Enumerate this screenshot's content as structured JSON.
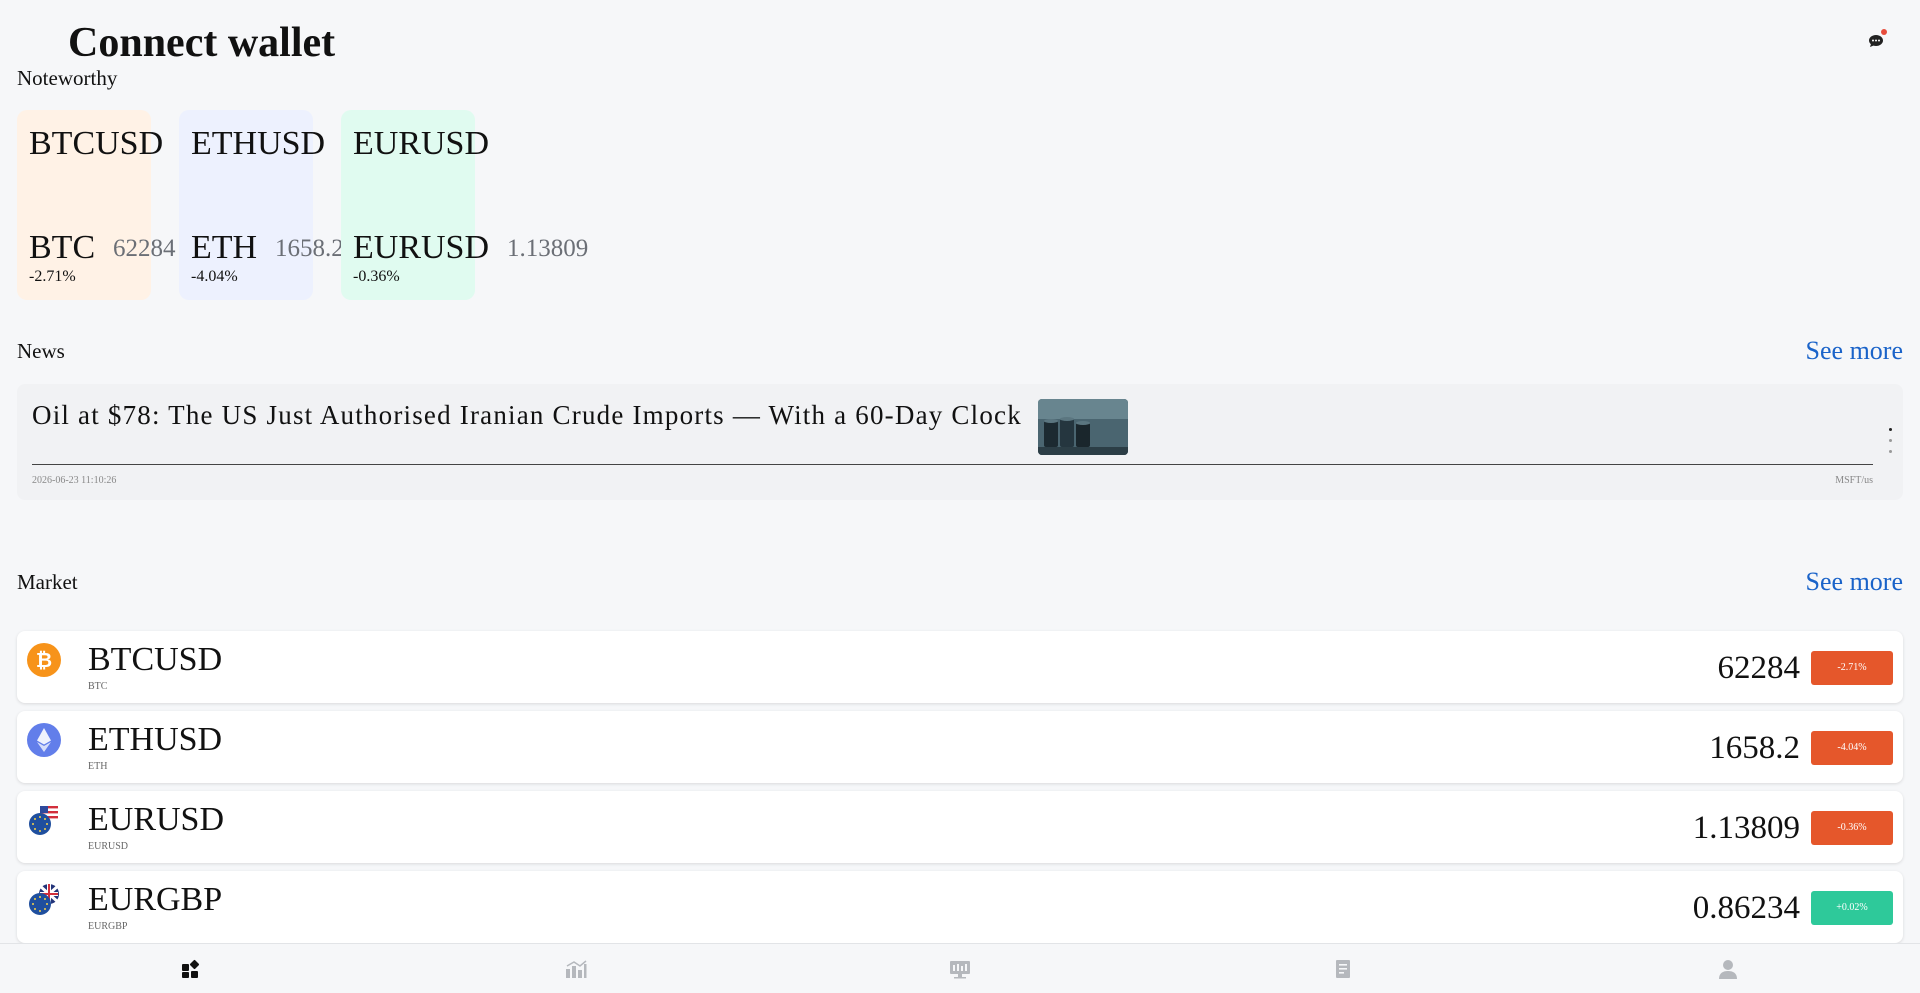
{
  "header": {
    "title": "Connect wallet",
    "chat_icon": "chat-bubble-icon"
  },
  "colors": {
    "accent": "#1a63c9",
    "negative": "#e5572b",
    "positive": "#2ec99a",
    "btc_card": "#fff2e6",
    "eth_card": "#edf1fe",
    "eur_card": "#e0fbf0"
  },
  "noteworthy": {
    "label": "Noteworthy",
    "cards": [
      {
        "symbol": "BTCUSD",
        "base": "BTC",
        "price": "62284",
        "change": "-2.71%"
      },
      {
        "symbol": "ETHUSD",
        "base": "ETH",
        "price": "1658.2",
        "change": "-4.04%"
      },
      {
        "symbol": "EURUSD",
        "base": "EURUSD",
        "price": "1.13809",
        "change": "-0.36%"
      }
    ]
  },
  "news": {
    "label": "News",
    "see_more": "See more",
    "items": [
      {
        "headline": "Oil at $78: The US Just Authorised Iranian Crude Imports — With a 60-Day Clock",
        "time": "2026-06-23 11:10:26",
        "source": "MSFT/us"
      }
    ]
  },
  "market": {
    "label": "Market",
    "see_more": "See more",
    "rows": [
      {
        "symbol": "BTCUSD",
        "base": "BTC",
        "price": "62284",
        "change": "-2.71%",
        "direction": "down",
        "icon": "bitcoin-icon"
      },
      {
        "symbol": "ETHUSD",
        "base": "ETH",
        "price": "1658.2",
        "change": "-4.04%",
        "direction": "down",
        "icon": "ethereum-icon"
      },
      {
        "symbol": "EURUSD",
        "base": "EURUSD",
        "price": "1.13809",
        "change": "-0.36%",
        "direction": "down",
        "icon": "eu-us-flag-icon"
      },
      {
        "symbol": "EURGBP",
        "base": "EURGBP",
        "price": "0.86234",
        "change": "+0.02%",
        "direction": "up",
        "icon": "eu-uk-flag-icon"
      }
    ]
  },
  "bottom_nav": {
    "items": [
      {
        "icon": "home-dashboard-icon",
        "active": true
      },
      {
        "icon": "market-chart-icon",
        "active": false
      },
      {
        "icon": "trade-terminal-icon",
        "active": false
      },
      {
        "icon": "orders-document-icon",
        "active": false
      },
      {
        "icon": "profile-user-icon",
        "active": false
      }
    ]
  }
}
